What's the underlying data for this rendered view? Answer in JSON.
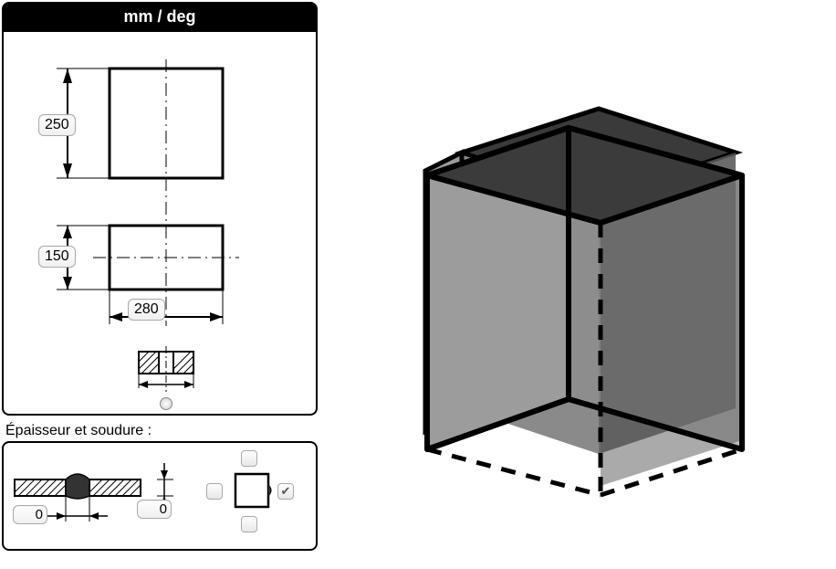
{
  "units_header": "mm / deg",
  "dimensions": {
    "height": "250",
    "depth": "150",
    "width": "280"
  },
  "weld_section": {
    "label": "Épaisseur et soudure :",
    "thickness1": "0",
    "thickness2": "0",
    "face_top_checked": false,
    "face_right_checked": true,
    "face_bottom_checked": false,
    "face_left_checked": false
  }
}
